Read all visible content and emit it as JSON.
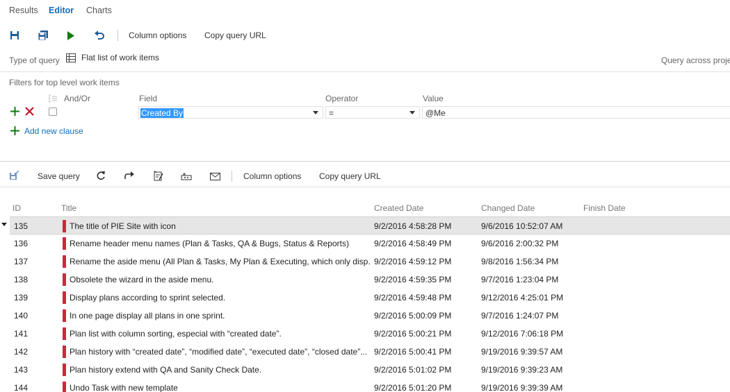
{
  "tabs": [
    {
      "label": "Results"
    },
    {
      "label": "Editor"
    },
    {
      "label": "Charts"
    }
  ],
  "toolbar1": {
    "column_options": "Column options",
    "copy_query_url": "Copy query URL"
  },
  "query": {
    "type_label": "Type of query",
    "type_value": "Flat list of work items",
    "across_label": "Query across proje"
  },
  "filters": {
    "title": "Filters for top level work items",
    "andor_header": "And/Or",
    "field_header": "Field",
    "operator_header": "Operator",
    "value_header": "Value",
    "field_value": "Created By",
    "operator_value": "=",
    "value_value": "@Me",
    "add_clause": "Add new clause"
  },
  "toolbar2": {
    "save_query": "Save query",
    "column_options": "Column options",
    "copy_query_url": "Copy query URL"
  },
  "grid": {
    "headers": {
      "id": "ID",
      "title": "Title",
      "created": "Created Date",
      "changed": "Changed Date",
      "finish": "Finish Date"
    },
    "rows": [
      {
        "id": "135",
        "title": "The title of PIE Site with icon",
        "created": "9/2/2016 4:58:28 PM",
        "changed": "9/6/2016 10:52:07 AM"
      },
      {
        "id": "136",
        "title": "Rename header menu names (Plan & Tasks, QA & Bugs, Status & Reports)",
        "created": "9/2/2016 4:58:49 PM",
        "changed": "9/6/2016 2:00:32 PM"
      },
      {
        "id": "137",
        "title": "Rename the aside menu (All Plan & Tasks, My Plan & Executing, which only disp...",
        "created": "9/2/2016 4:59:12 PM",
        "changed": "9/8/2016 1:56:34 PM"
      },
      {
        "id": "138",
        "title": "Obsolete the wizard in the aside menu.",
        "created": "9/2/2016 4:59:35 PM",
        "changed": "9/7/2016 1:23:04 PM"
      },
      {
        "id": "139",
        "title": "Display plans according to sprint selected.",
        "created": "9/2/2016 4:59:48 PM",
        "changed": "9/12/2016 4:25:01 PM"
      },
      {
        "id": "140",
        "title": "In one page display all plans in one sprint.",
        "created": "9/2/2016 5:00:09 PM",
        "changed": "9/7/2016 1:24:07 PM"
      },
      {
        "id": "141",
        "title": "Plan list with column sorting, especial with “created date”.",
        "created": "9/2/2016 5:00:21 PM",
        "changed": "9/12/2016 7:06:18 PM"
      },
      {
        "id": "142",
        "title": "Plan history with “created date”, “modified date”, “executed date”, “closed date”...",
        "created": "9/2/2016 5:00:41 PM",
        "changed": "9/19/2016 9:39:57 AM"
      },
      {
        "id": "143",
        "title": "Plan history extend with QA and Sanity Check Date.",
        "created": "9/2/2016 5:01:02 PM",
        "changed": "9/19/2016 9:39:23 AM"
      },
      {
        "id": "144",
        "title": "Undo Task with new template",
        "created": "9/2/2016 5:01:20 PM",
        "changed": "9/19/2016 9:39:39 AM"
      }
    ]
  },
  "colors": {
    "accent": "#106ebe",
    "work_item_bar": "#cc293d",
    "play": "#107c10",
    "delete": "#c8102e"
  }
}
